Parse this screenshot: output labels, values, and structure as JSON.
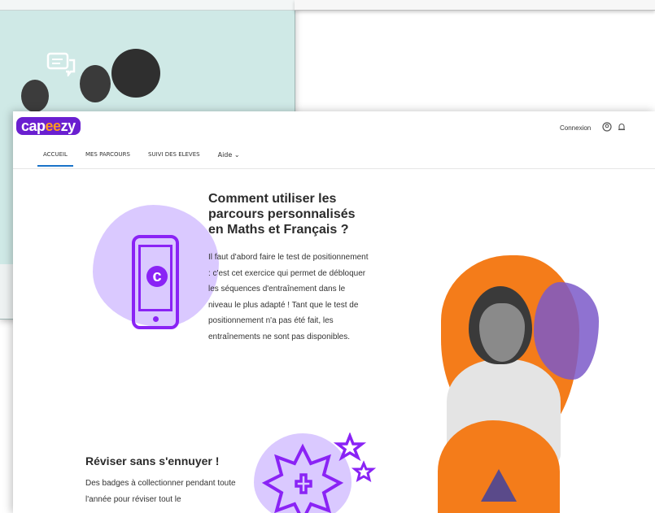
{
  "header": {
    "logo": {
      "pre": "cap",
      "ee": "ee",
      "post": "zy"
    },
    "connexion": "Connexion",
    "icons": [
      "user-icon",
      "bell-icon"
    ]
  },
  "nav": [
    {
      "label": "ACCUEIL",
      "active": true
    },
    {
      "label": "MES PARCOURS",
      "active": false
    },
    {
      "label": "SUIVI DES ELEVES",
      "active": false
    },
    {
      "label": "Aide",
      "active": false
    }
  ],
  "section1": {
    "title": "Comment utiliser les parcours personnalisés en Maths et Français ?",
    "text": "Il faut d'abord faire le test de positionnement : c'est cet exercice qui permet de débloquer les séquences d'entraînement dans le niveau le plus adapté ! Tant que le test de positionnement n'a pas été fait, les entraînements ne sont pas disponibles."
  },
  "section2": {
    "title": "Réviser sans s'ennuyer !",
    "text": "Des badges à collectionner pendant toute l'année pour réviser tout le"
  },
  "colors": {
    "brand_purple": "#6a1fd0",
    "brand_orange": "#f47c1a",
    "lavender": "#dac9ff",
    "nav_underline": "#1a73c9"
  }
}
